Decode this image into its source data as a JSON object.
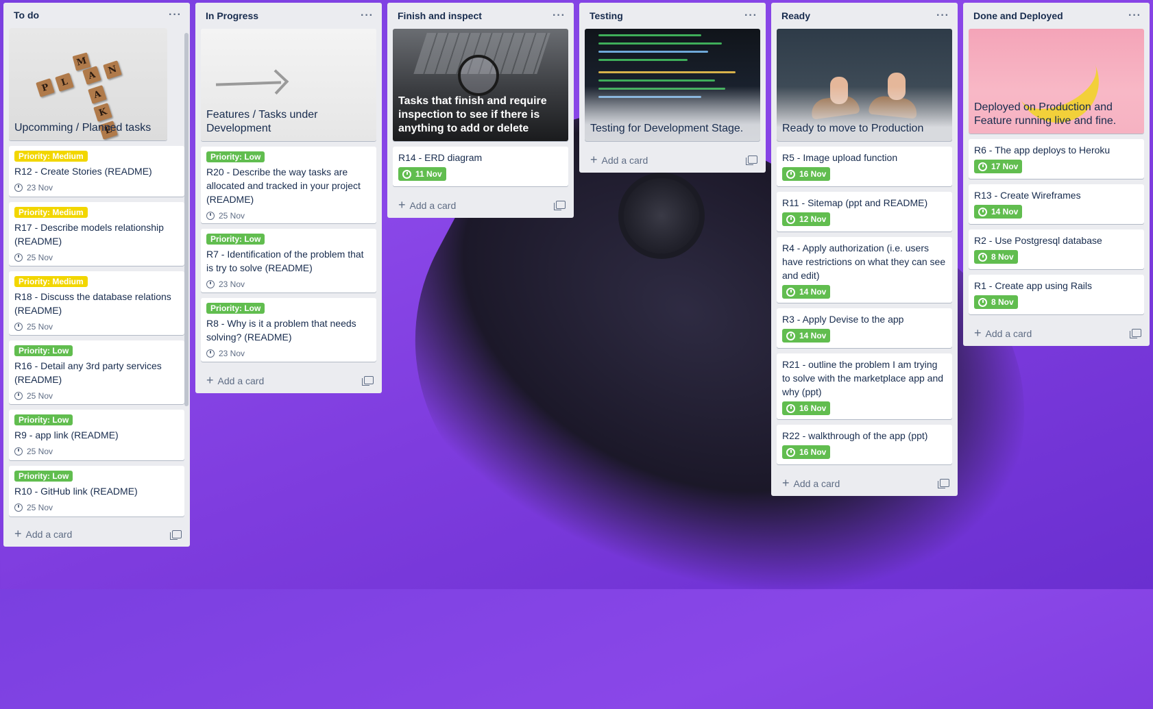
{
  "lists": [
    {
      "title": "To do",
      "cover": "Upcomming / Planned tasks",
      "cards": [
        {
          "label": "Priority: Medium",
          "level": "medium",
          "title": "R12 - Create Stories (README)",
          "date": "23 Nov"
        },
        {
          "label": "Priority: Medium",
          "level": "medium",
          "title": "R17 - Describe models relationship (README)",
          "date": "25 Nov"
        },
        {
          "label": "Priority: Medium",
          "level": "medium",
          "title": "R18 - Discuss the database relations (README)",
          "date": "25 Nov"
        },
        {
          "label": "Priority: Low",
          "level": "low",
          "title": "R16 - Detail any 3rd party services (README)",
          "date": "25 Nov"
        },
        {
          "label": "Priority: Low",
          "level": "low",
          "title": "R9 - app link (README)",
          "date": "25 Nov"
        },
        {
          "label": "Priority: Low",
          "level": "low",
          "title": "R10 - GitHub link (README)",
          "date": "25 Nov"
        }
      ],
      "add_label": "Add a card"
    },
    {
      "title": "In Progress",
      "cover": "Features / Tasks under Development",
      "cards": [
        {
          "label": "Priority: Low",
          "level": "low",
          "title": "R20 - Describe the way tasks are allocated and tracked in your project (README)",
          "date": "25 Nov"
        },
        {
          "label": "Priority: Low",
          "level": "low",
          "title": "R7 - Identification of the problem that is try to solve (README)",
          "date": "23 Nov"
        },
        {
          "label": "Priority: Low",
          "level": "low",
          "title": "R8 - Why is it a problem that needs solving? (README)",
          "date": "23 Nov"
        }
      ],
      "add_label": "Add a card"
    },
    {
      "title": "Finish and inspect",
      "cover": "Tasks that finish and require inspection to see if there is anything to add or delete",
      "cards": [
        {
          "title": "R14 - ERD diagram",
          "date": "11 Nov"
        }
      ],
      "add_label": "Add a card"
    },
    {
      "title": "Testing",
      "cover": "Testing for Development Stage.",
      "cards": [],
      "add_label": "Add a card"
    },
    {
      "title": "Ready",
      "cover": "Ready to move to Production",
      "cards": [
        {
          "title": "R5 - Image upload function",
          "date": "16 Nov"
        },
        {
          "title": "R11 - Sitemap (ppt and README)",
          "date": "12 Nov"
        },
        {
          "title": "R4 - Apply authorization (i.e. users have restrictions on what they can see and edit)",
          "date": "14 Nov"
        },
        {
          "title": "R3 - Apply Devise to the app",
          "date": "14 Nov"
        },
        {
          "title": "R21 - outline the problem I am trying to solve with the marketplace app and why (ppt)",
          "date": "16 Nov"
        },
        {
          "title": "R22 - walkthrough of the app (ppt)",
          "date": "16 Nov"
        }
      ],
      "add_label": "Add a card"
    },
    {
      "title": "Done and Deployed",
      "cover": "Deployed on Production and Feature running live and fine.",
      "cards": [
        {
          "title": "R6 - The app deploys to Heroku",
          "date": "17 Nov"
        },
        {
          "title": "R13 - Create Wireframes",
          "date": "14 Nov"
        },
        {
          "title": "R2 - Use Postgresql database",
          "date": "8 Nov"
        },
        {
          "title": "R1 - Create app using Rails",
          "date": "8 Nov"
        }
      ],
      "add_label": "Add a card"
    }
  ],
  "menu_glyph": "···",
  "plus_glyph": "+",
  "icons": {
    "menu": "more-icon",
    "clock": "clock-icon",
    "add": "plus-icon",
    "template": "card-template-icon"
  },
  "colors": {
    "background": "#7e3cde",
    "list_bg": "#ebecf0",
    "label_medium": "#f2d600",
    "label_low": "#61bd4f",
    "due_badge": "#61bd4f"
  },
  "scrabble_tiles": [
    "M",
    "P",
    "L",
    "A",
    "N",
    "A",
    "K",
    "E"
  ]
}
